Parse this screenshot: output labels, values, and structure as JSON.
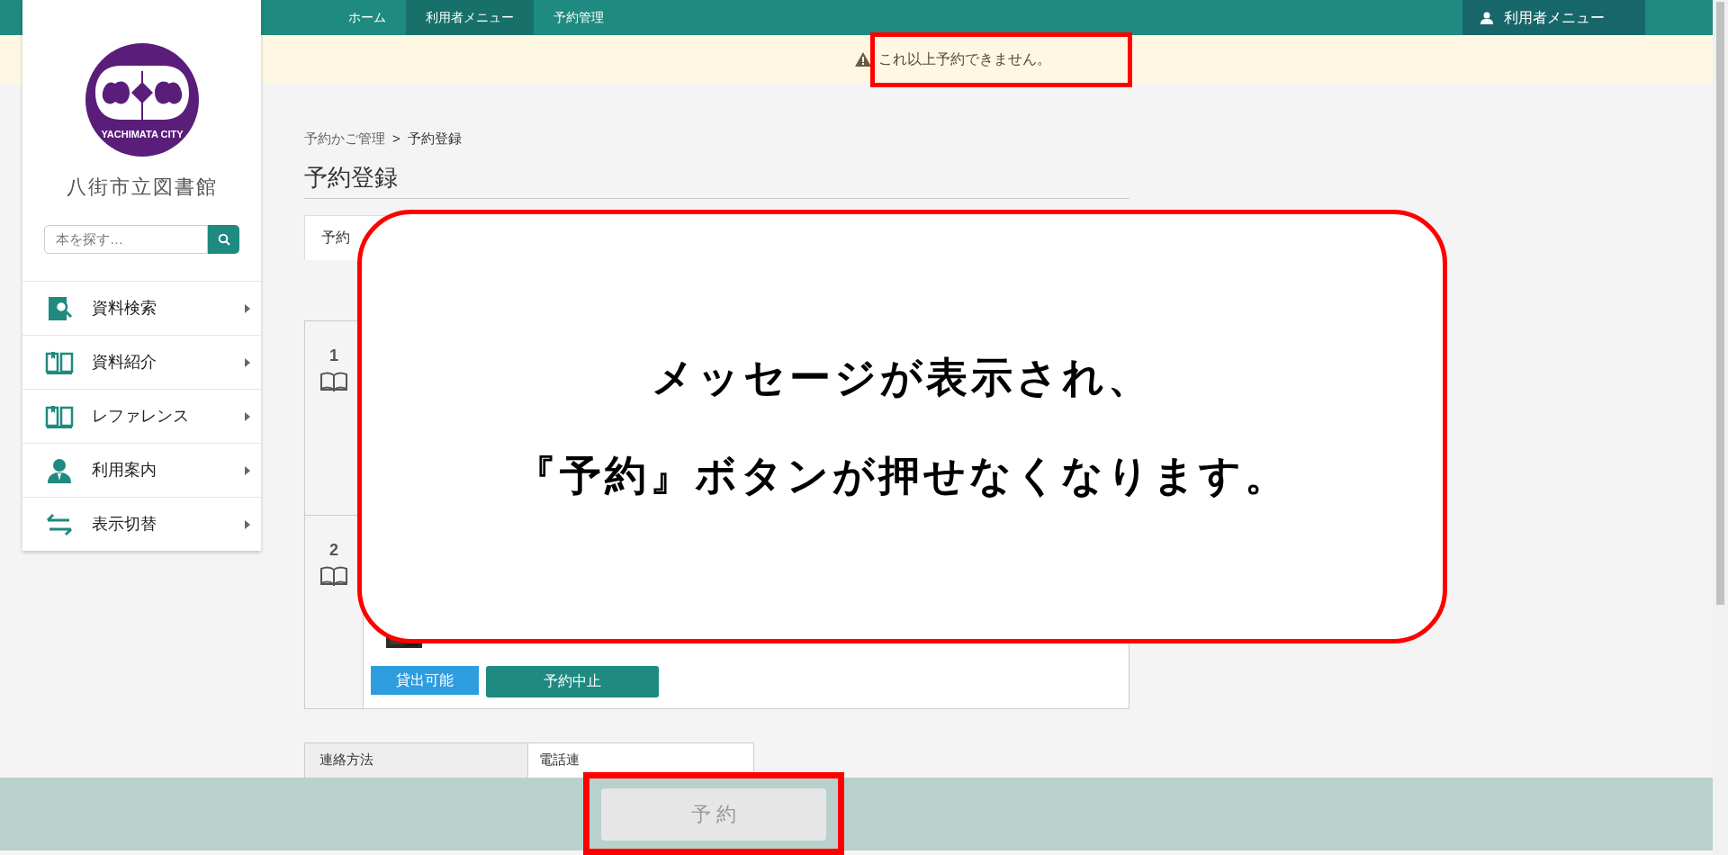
{
  "nav": {
    "breadcrumb": [
      {
        "label": "ホーム",
        "selected": false
      },
      {
        "label": "利用者メニュー",
        "selected": true
      },
      {
        "label": "予約管理",
        "selected": false
      }
    ],
    "user_menu": "利用者メニュー"
  },
  "notice": "これ以上予約できません。",
  "sidebar": {
    "logo_text": "YACHIMATA CITY",
    "library_name": "八街市立図書館",
    "search": {
      "placeholder": "本を探す…"
    },
    "items": [
      {
        "label": "資料検索",
        "kind": "search"
      },
      {
        "label": "資料紹介",
        "kind": "book"
      },
      {
        "label": "レファレンス",
        "kind": "book"
      },
      {
        "label": "利用案内",
        "kind": "person"
      },
      {
        "label": "表示切替",
        "kind": "swap"
      }
    ]
  },
  "page": {
    "breadcrumb": [
      "予約かご管理",
      "予約登録"
    ],
    "breadcrumb_separator": ">",
    "title": "予約登録",
    "tab": "予約",
    "items": [
      {
        "number": "1"
      },
      {
        "number": "2",
        "status": "貸出可能",
        "cancel": "予約中止"
      }
    ],
    "contact": {
      "label": "連絡方法",
      "value": "電話連"
    }
  },
  "reserve_button": {
    "label": "予 約",
    "disabled": true
  },
  "callout": {
    "lines": [
      "メッセージが表示され、",
      "『予約』ボタンが押せなくなります。"
    ]
  }
}
